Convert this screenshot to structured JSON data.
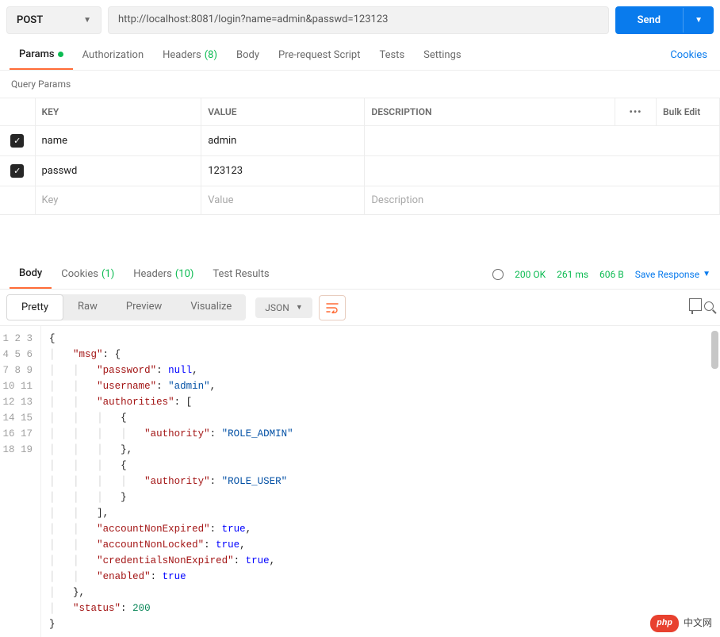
{
  "request": {
    "method": "POST",
    "url": "http://localhost:8081/login?name=admin&passwd=123123",
    "send_label": "Send"
  },
  "tabs": {
    "params": "Params",
    "authorization": "Authorization",
    "headers": "Headers",
    "headers_count": "(8)",
    "body": "Body",
    "prerequest": "Pre-request Script",
    "tests": "Tests",
    "settings": "Settings",
    "cookies": "Cookies"
  },
  "query_params": {
    "title": "Query Params",
    "columns": {
      "key": "KEY",
      "value": "VALUE",
      "description": "DESCRIPTION",
      "more": "•••",
      "bulk": "Bulk Edit"
    },
    "rows": [
      {
        "checked": true,
        "key": "name",
        "value": "admin",
        "description": ""
      },
      {
        "checked": true,
        "key": "passwd",
        "value": "123123",
        "description": ""
      }
    ],
    "placeholders": {
      "key": "Key",
      "value": "Value",
      "description": "Description"
    }
  },
  "response": {
    "tabs": {
      "body": "Body",
      "cookies": "Cookies",
      "cookies_count": "(1)",
      "headers": "Headers",
      "headers_count": "(10)",
      "test_results": "Test Results"
    },
    "status_label": "200 OK",
    "time_label": "261 ms",
    "size_label": "606 B",
    "save_label": "Save Response"
  },
  "viewer": {
    "modes": {
      "pretty": "Pretty",
      "raw": "Raw",
      "preview": "Preview",
      "visualize": "Visualize"
    },
    "lang": "JSON"
  },
  "code": {
    "lines": [
      "{",
      "    \"msg\": {",
      "        \"password\": null,",
      "        \"username\": \"admin\",",
      "        \"authorities\": [",
      "            {",
      "                \"authority\": \"ROLE_ADMIN\"",
      "            },",
      "            {",
      "                \"authority\": \"ROLE_USER\"",
      "            }",
      "        ],",
      "        \"accountNonExpired\": true,",
      "        \"accountNonLocked\": true,",
      "        \"credentialsNonExpired\": true,",
      "        \"enabled\": true",
      "    },",
      "    \"status\": 200",
      "}"
    ]
  },
  "watermark": {
    "badge": "php",
    "text": "中文网"
  }
}
